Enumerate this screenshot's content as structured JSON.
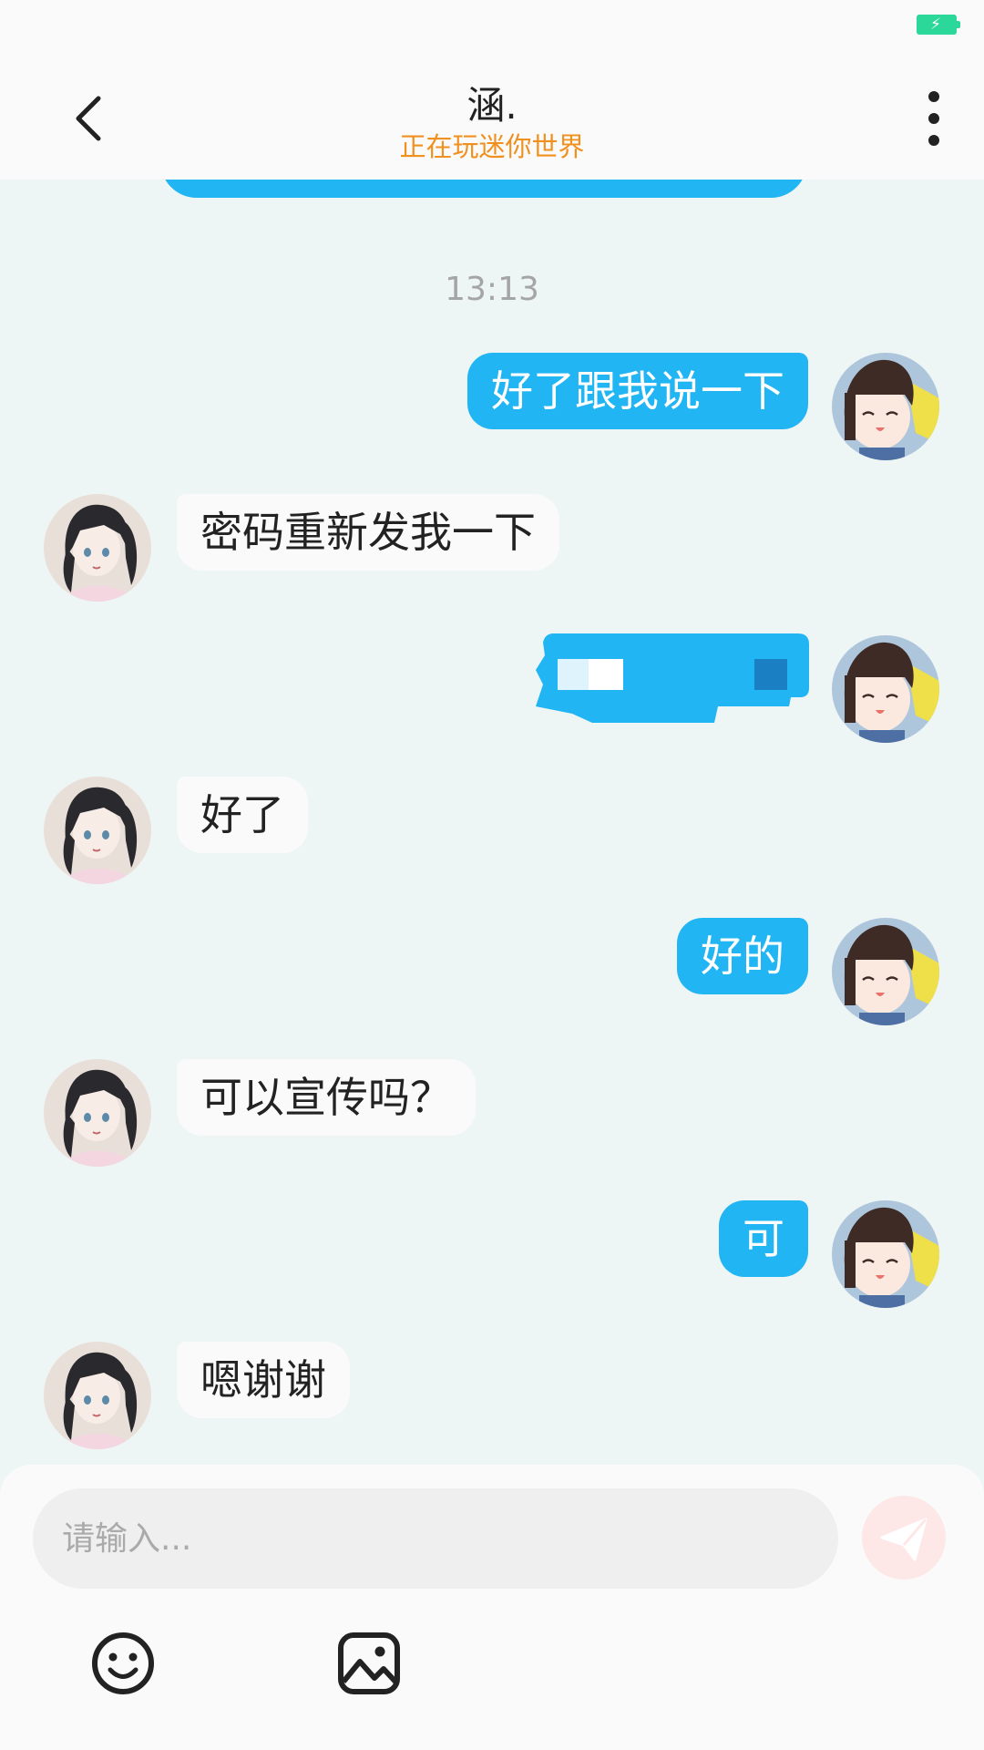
{
  "header": {
    "title": "涵.",
    "subtitle": "正在玩迷你世界"
  },
  "chat": {
    "timestamp": "13:13",
    "messages": [
      {
        "side": "mine",
        "text": "好了跟我说一下"
      },
      {
        "side": "theirs",
        "text": "密码重新发我一下"
      },
      {
        "side": "mine",
        "text": "",
        "note": "redacted"
      },
      {
        "side": "theirs",
        "text": "好了"
      },
      {
        "side": "mine",
        "text": "好的"
      },
      {
        "side": "theirs",
        "text": "可以宣传吗？"
      },
      {
        "side": "mine",
        "text": "可"
      },
      {
        "side": "theirs",
        "text": "嗯谢谢"
      }
    ]
  },
  "composer": {
    "placeholder": "请输入...",
    "value": ""
  },
  "icons": {
    "back": "chevron-left-icon",
    "menu": "more-vertical-icon",
    "send": "send-plane-icon",
    "emoji": "smiley-icon",
    "image": "image-icon"
  },
  "colors": {
    "accent": "#21b5f4",
    "subtitle": "#f0901e",
    "background": "#eef5f5"
  }
}
